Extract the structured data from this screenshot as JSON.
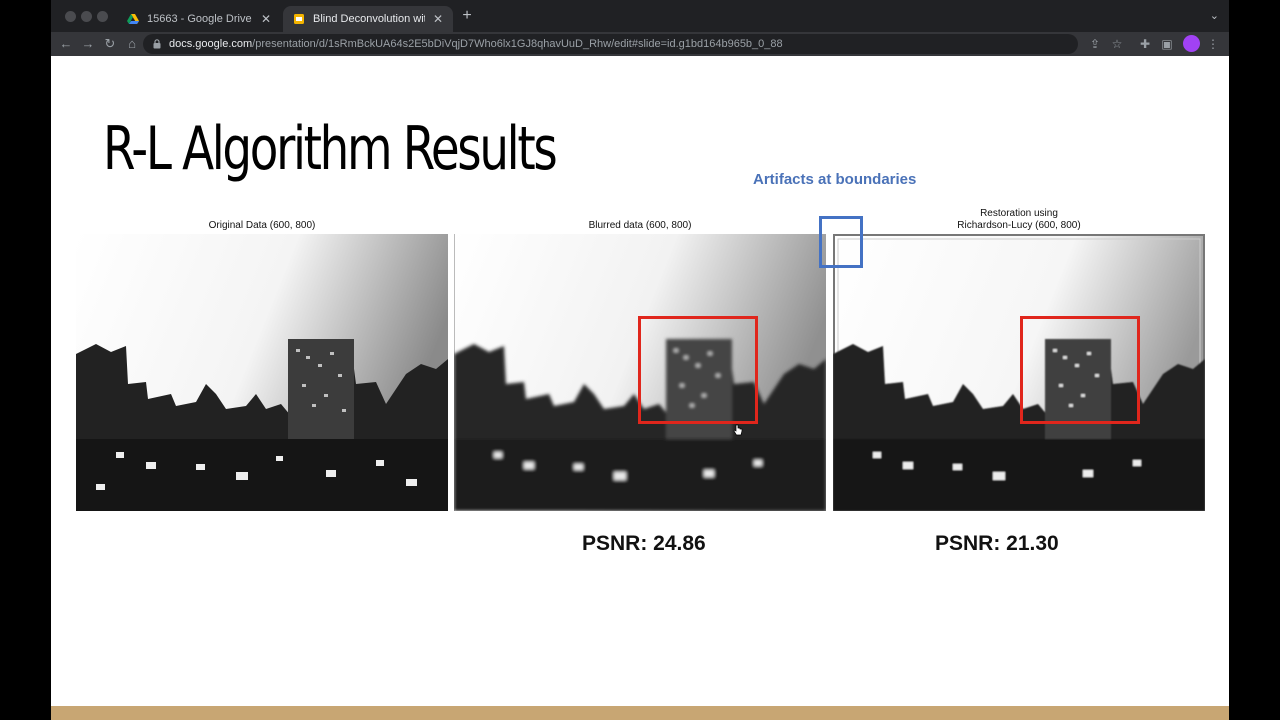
{
  "tabs": [
    {
      "label": "15663 - Google Drive",
      "icon": "google-drive-icon",
      "active": false
    },
    {
      "label": "Blind Deconvolution with Richa",
      "icon": "google-slides-icon",
      "active": true
    }
  ],
  "address_bar": {
    "domain": "docs.google.com",
    "path": "/presentation/d/1sRmBckUA64s2E5bDiVqjD7Who6lx1GJ8qhavUuD_Rhw/edit#slide=id.g1bd164b965b_0_88"
  },
  "slide": {
    "title": "R-L Algorithm Results",
    "annotation": "Artifacts at boundaries",
    "panels": [
      {
        "title_line1": "Original Data (600, 800)",
        "title_line2": ""
      },
      {
        "title_line1": "Blurred data (600, 800)",
        "title_line2": ""
      },
      {
        "title_line1": "Restoration using",
        "title_line2": "Richardson-Lucy (600, 800)"
      }
    ],
    "psnr": [
      {
        "label": "PSNR: 24.86"
      },
      {
        "label": "PSNR: 21.30"
      }
    ]
  },
  "colors": {
    "accent_blue_text": "#4a72b8",
    "blue_box": "#4472c4",
    "red_box": "#e0261c",
    "bottom_bar": "#c8a673"
  }
}
